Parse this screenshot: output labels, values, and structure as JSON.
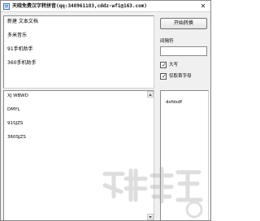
{
  "window": {
    "title": "天晓免费汉字转拼音(qq:348961183,cddz-wf1@163.com)",
    "close_glyph": "✕"
  },
  "input_box": {
    "lines": [
      "新建 文本文档",
      "多米音乐",
      "91手机助手",
      "360手机助手"
    ]
  },
  "output_box": {
    "lines": [
      "XJ WBWD",
      "DMYL",
      "91SJZS",
      "360SJZS"
    ]
  },
  "right_box": {
    "lines": [
      "dsfdsdf"
    ]
  },
  "controls": {
    "convert_button": "开始转换",
    "separator_label": "间隔符",
    "separator_value": "",
    "checkbox_uppercase": "大写",
    "checkbox_uppercase_checked": true,
    "checkbox_initials": "仅取首字母",
    "checkbox_initials_checked": true
  }
}
